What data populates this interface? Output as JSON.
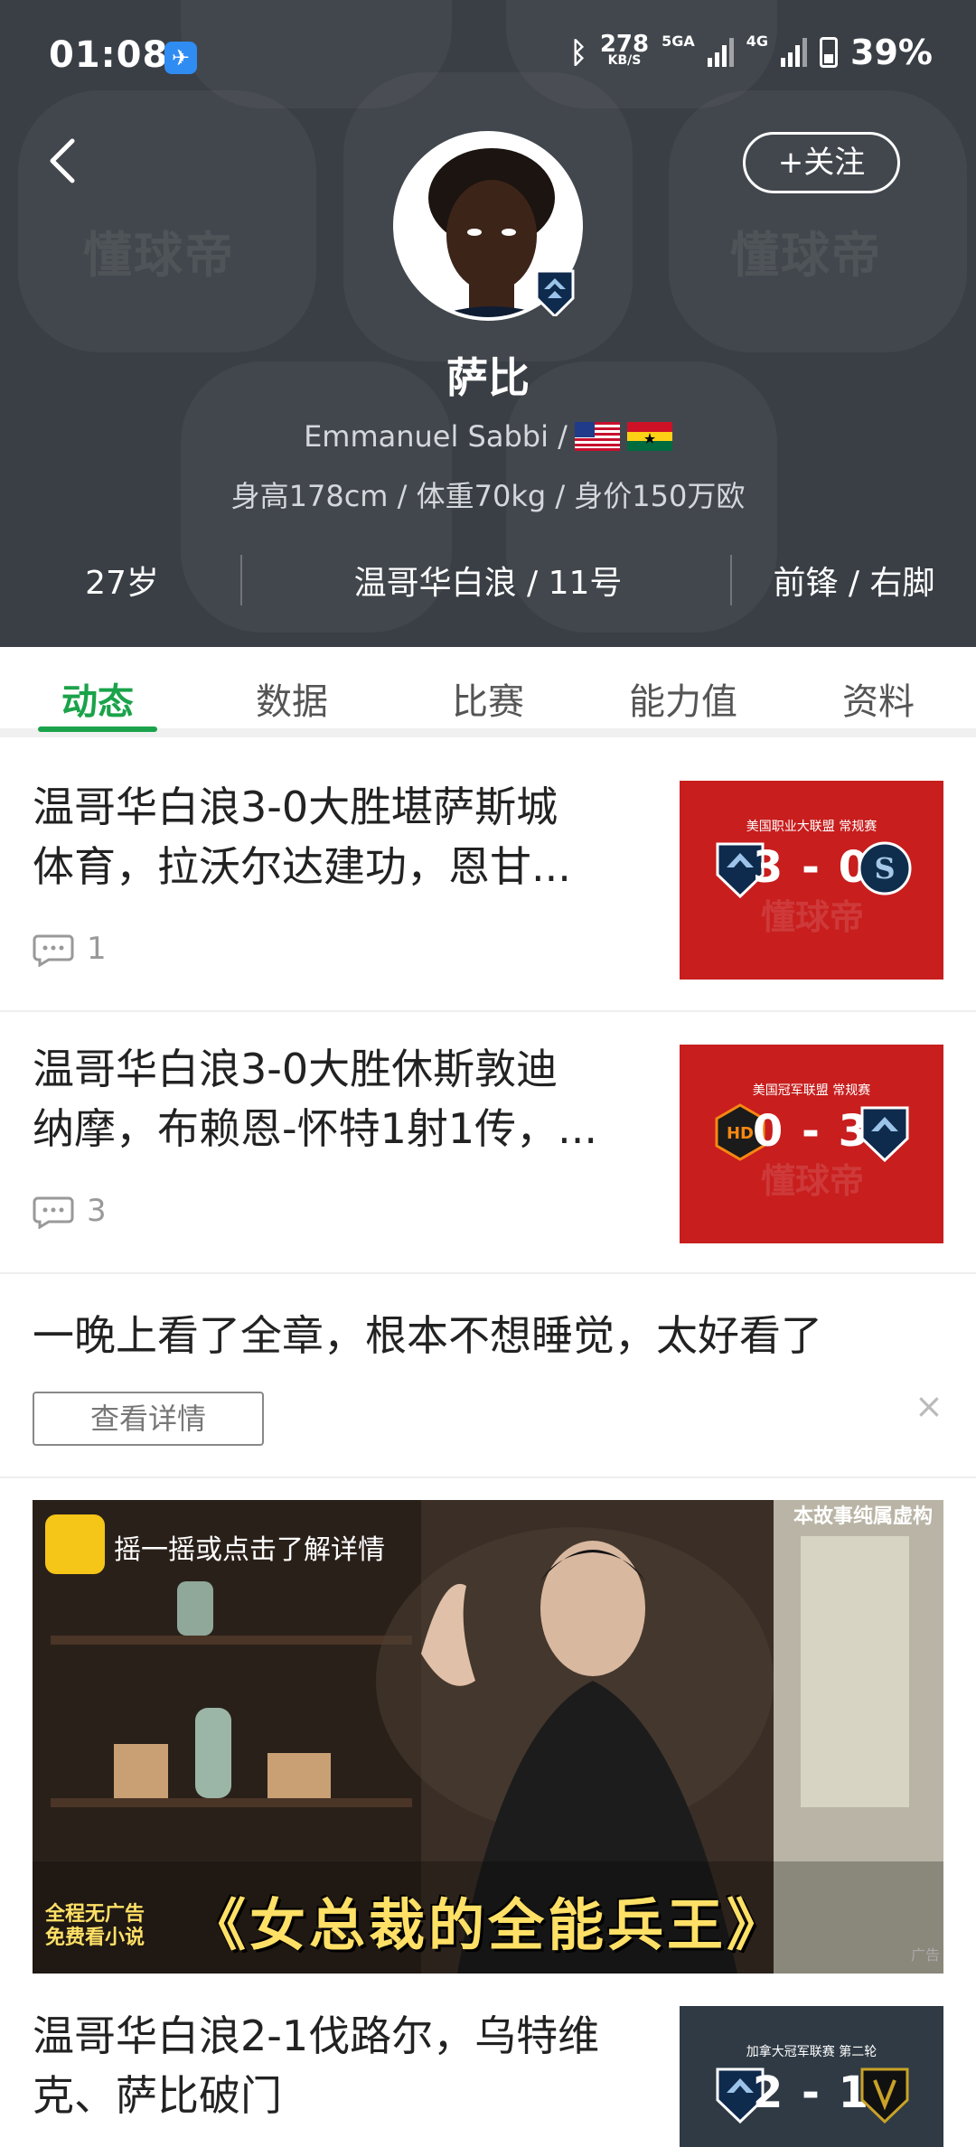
{
  "status_bar": {
    "time": "01:08",
    "net_speed_top": "278",
    "net_speed_bottom": "KB/S",
    "sim1": "5GA",
    "sim2": "4G",
    "battery": "39%"
  },
  "header": {
    "follow_label": "+关注",
    "watermark": "懂球帝",
    "name_cn": "萨比",
    "name_en": "Emmanuel Sabbi /",
    "stats": "身高178cm / 体重70kg / 身价150万欧",
    "age": "27岁",
    "club_number": "温哥华白浪 / 11号",
    "position_foot": "前锋 / 右脚"
  },
  "tabs": [
    {
      "label": "动态",
      "active": true
    },
    {
      "label": "数据",
      "active": false
    },
    {
      "label": "比赛",
      "active": false
    },
    {
      "label": "能力值",
      "active": false
    },
    {
      "label": "资料",
      "active": false
    }
  ],
  "feed": {
    "items": [
      {
        "title_line1": "温哥华白浪3-0大胜堪萨斯城",
        "title_line2": "体育，拉沃尔达建功，恩甘...",
        "comments": "1",
        "thumb_label": "美国职业大联盟 常规赛",
        "thumb_score": "3 - 0"
      },
      {
        "title_line1": "温哥华白浪3-0大胜休斯敦迪",
        "title_line2": "纳摩，布赖恩-怀特1射1传，...",
        "comments": "3",
        "thumb_label": "美国冠军联盟 常规赛",
        "thumb_score": "0 - 3"
      },
      {
        "title_line1": "温哥华白浪2-1伐路尔，乌特维",
        "title_line2": "克、萨比破门",
        "thumb_label": "加拿大冠军联赛 第二轮",
        "thumb_score": "2 - 1"
      }
    ],
    "promo": {
      "text": "一晚上看了全章，根本不想睡觉，太好看了",
      "button": "查看详情",
      "close": "×"
    },
    "ad": {
      "shake_text": "摇一摇或点击了解详情",
      "note": "本故事纯属虚构",
      "corner_line1": "全程无广告",
      "corner_line2": "免费看小说",
      "title": "《女总裁的全能兵王》",
      "tag": "广告"
    }
  }
}
